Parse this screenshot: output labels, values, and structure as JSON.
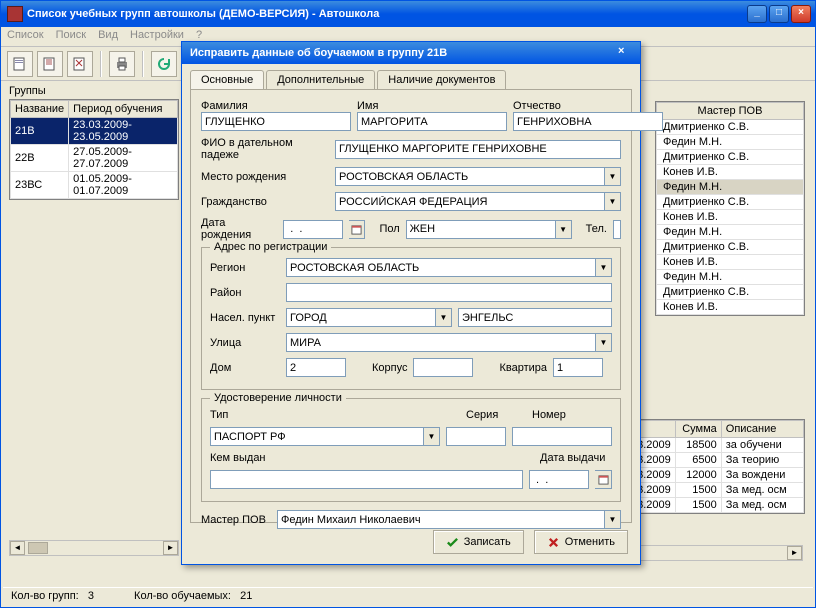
{
  "main": {
    "title": "Список учебных групп автошколы (ДЕМО-ВЕРСИЯ) - Автошкола",
    "menu": [
      "Список",
      "Поиск",
      "Вид",
      "Настройки",
      "?"
    ]
  },
  "groups": {
    "title": "Группы",
    "columns": [
      "Название",
      "Период обучения"
    ],
    "rows": [
      {
        "name": "21В",
        "period": "23.03.2009-23.05.2009",
        "selected": true
      },
      {
        "name": "22В",
        "period": "27.05.2009-27.07.2009"
      },
      {
        "name": "23ВС",
        "period": "01.05.2009-01.07.2009"
      }
    ]
  },
  "masters": {
    "header": "Мастер ПОВ",
    "rows": [
      "Дмитриенко С.В.",
      "Федин М.Н.",
      "Дмитриенко С.В.",
      "Конев И.В.",
      "Федин М.Н.",
      "Дмитриенко С.В.",
      "Конев И.В.",
      "Федин М.Н.",
      "Дмитриенко С.В.",
      "Конев И.В.",
      "Федин М.Н.",
      "Дмитриенко С.В.",
      "Конев И.В."
    ],
    "highlight_index": 4
  },
  "payments": {
    "columns": [
      "",
      "Сумма",
      "Описание"
    ],
    "rows": [
      {
        "date": "03.2009",
        "sum": "18500",
        "desc": "за обучени"
      },
      {
        "date": "03.2009",
        "sum": "6500",
        "desc": "За теорию"
      },
      {
        "date": "03.2009",
        "sum": "12000",
        "desc": "За вождени"
      },
      {
        "date": "03.2009",
        "sum": "1500",
        "desc": "За мед. осм"
      },
      {
        "date": "03.2009",
        "sum": "1500",
        "desc": "За мед. осм"
      }
    ]
  },
  "status": {
    "groups_label": "Кол-во групп:",
    "groups_count": "3",
    "students_label": "Кол-во обучаемых:",
    "students_count": "21"
  },
  "dialog": {
    "title": "Исправить данные об боучаемом в группу 21В",
    "tabs": [
      "Основные",
      "Дополнительные",
      "Наличие документов"
    ],
    "labels": {
      "surname": "Фамилия",
      "name": "Имя",
      "patronymic": "Отчество",
      "fio_dative": "ФИО в дательном падеже",
      "birth_place": "Место рождения",
      "citizenship": "Гражданство",
      "birth_date": "Дата рождения",
      "sex": "Пол",
      "phone": "Тел.",
      "reg_group": "Адрес по регистрации",
      "region": "Регион",
      "district": "Район",
      "locality": "Насел. пункт",
      "street": "Улица",
      "house": "Дом",
      "building": "Корпус",
      "apt": "Квартира",
      "id_group": "Удостоверение личности",
      "id_type": "Тип",
      "id_series": "Серия",
      "id_number": "Номер",
      "issued_by": "Кем выдан",
      "issue_date": "Дата выдачи",
      "master": "Мастер ПОВ",
      "save": "Записать",
      "cancel": "Отменить"
    },
    "values": {
      "surname": "ГЛУЩЕНКО",
      "name": "МАРГОРИТА",
      "patronymic": "ГЕНРИХОВНА",
      "fio_dative": "ГЛУЩЕНКО МАРГОРИТЕ ГЕНРИХОВНЕ",
      "birth_place": "РОСТОВСКАЯ ОБЛАСТЬ",
      "citizenship": "РОССИЙСКАЯ ФЕДЕРАЦИЯ",
      "birth_date": " .  .",
      "sex": "ЖЕН",
      "phone": "",
      "region": "РОСТОВСКАЯ ОБЛАСТЬ",
      "district": "",
      "locality_type": "ГОРОД",
      "locality": "ЭНГЕЛЬС",
      "street": "МИРА",
      "house": "2",
      "building": "",
      "apt": "1",
      "id_type": "ПАСПОРТ РФ",
      "id_series": "",
      "id_number": "",
      "issued_by": "",
      "issue_date": " .  .",
      "master": "Федин Михаил Николаевич"
    }
  }
}
